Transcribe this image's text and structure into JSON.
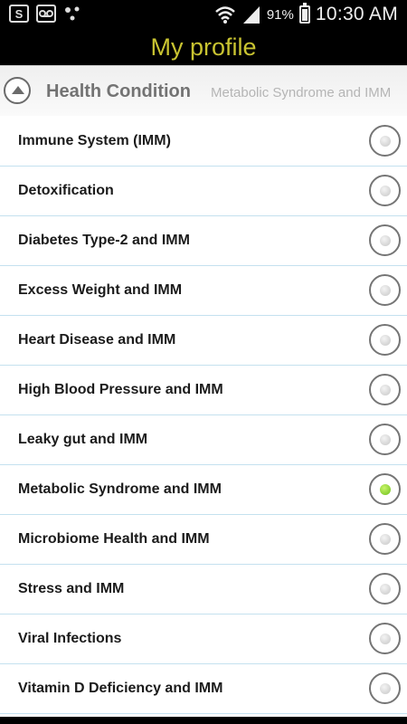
{
  "status_bar": {
    "icons": [
      "sync-icon",
      "voicemail-icon",
      "dots-icon",
      "wifi-icon",
      "signal-icon"
    ],
    "battery_percent": "91%",
    "time": "10:30 AM"
  },
  "app_bar": {
    "title": "My profile"
  },
  "section": {
    "title": "Health Condition",
    "selected_value": "Metabolic Syndrome and IMM"
  },
  "options": [
    {
      "label": "Immune System (IMM)",
      "selected": false
    },
    {
      "label": "Detoxification",
      "selected": false
    },
    {
      "label": "Diabetes Type-2 and IMM",
      "selected": false
    },
    {
      "label": "Excess Weight and IMM",
      "selected": false
    },
    {
      "label": "Heart Disease and IMM",
      "selected": false
    },
    {
      "label": "High Blood Pressure and IMM",
      "selected": false
    },
    {
      "label": "Leaky gut and IMM",
      "selected": false
    },
    {
      "label": "Metabolic Syndrome and IMM",
      "selected": true
    },
    {
      "label": "Microbiome Health and IMM",
      "selected": false
    },
    {
      "label": "Stress and IMM",
      "selected": false
    },
    {
      "label": "Viral Infections",
      "selected": false
    },
    {
      "label": "Vitamin D Deficiency and IMM",
      "selected": false
    }
  ],
  "colors": {
    "title_text": "#c9c431",
    "selected_radio": "#7cd11f",
    "divider": "#c4e1ef"
  }
}
